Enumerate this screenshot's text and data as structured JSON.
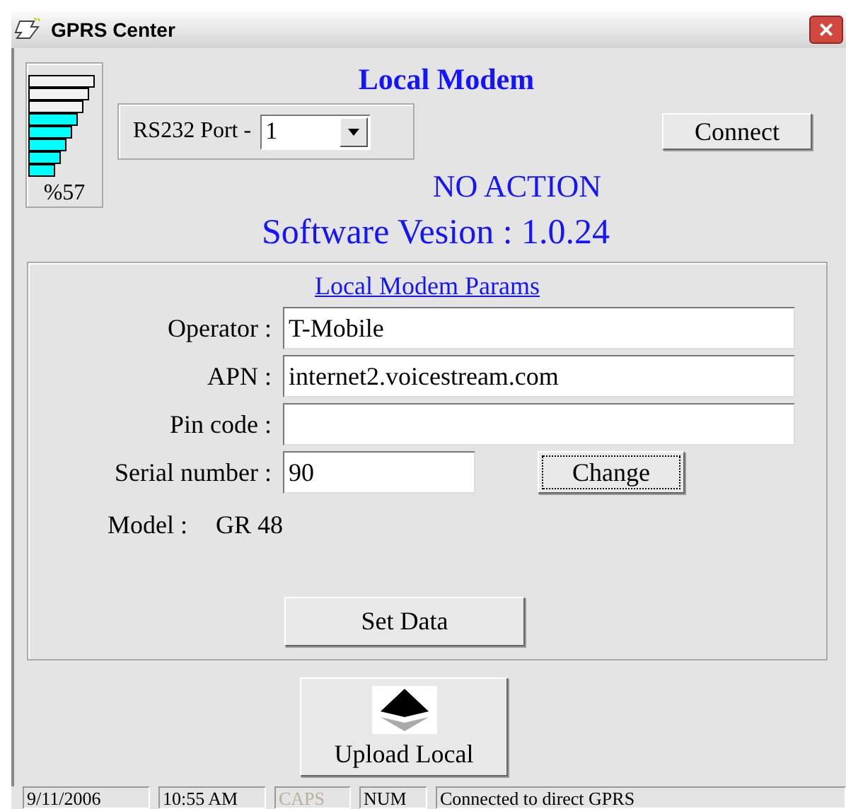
{
  "window": {
    "title": "GPRS Center",
    "close": "×"
  },
  "signal": {
    "level": 0.57,
    "reading": "%57"
  },
  "heading": "Local Modem",
  "port": {
    "label": "RS232 Port -",
    "value": "1"
  },
  "connect_button": "Connect",
  "status_message": "NO ACTION",
  "version": "Software Vesion : 1.0.24",
  "params": {
    "title": "Local Modem Params",
    "fields": [
      {
        "label": "Operator :",
        "value": "T-Mobile"
      },
      {
        "label": "APN :",
        "value": "internet2.voicestream.com"
      },
      {
        "label": "Pin code :"
      },
      {
        "label": "Serial number :",
        "value": "90"
      }
    ],
    "change_button": "Change",
    "model_label": "Model :",
    "model_value": "GR 48",
    "set_button": "Set Data"
  },
  "upload_button": "Upload Local",
  "status_bar": [
    {
      "text": "9/11/2006",
      "on": true
    },
    {
      "text": "10:55 AM",
      "on": true
    },
    {
      "text": "CAPS",
      "on": false
    },
    {
      "text": "NUM",
      "on": true
    },
    {
      "text": "Connected to direct GPRS",
      "on": true
    }
  ]
}
